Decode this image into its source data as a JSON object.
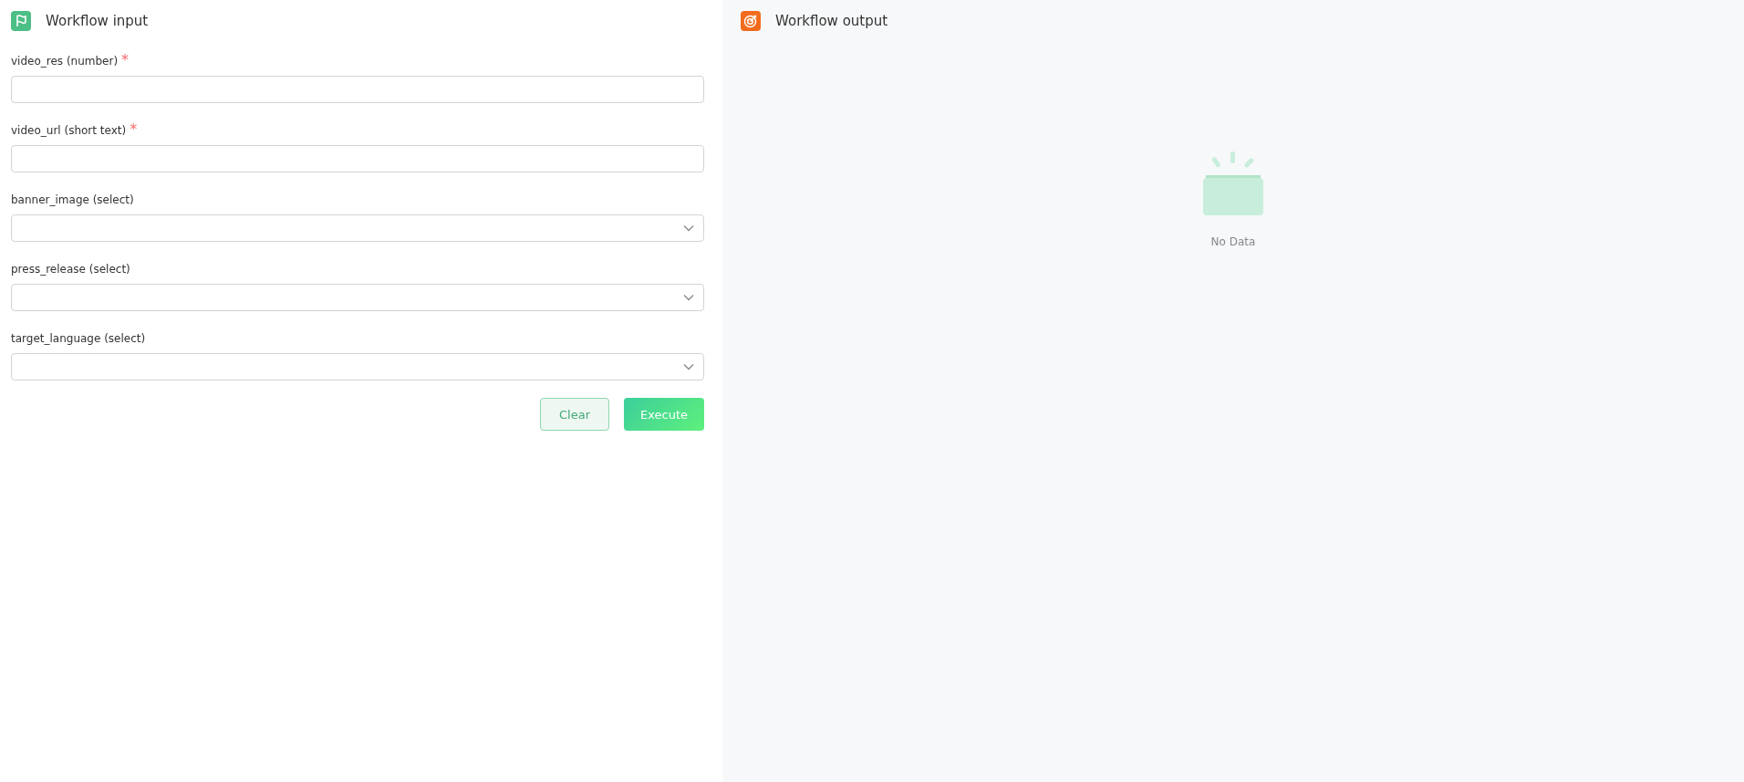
{
  "input_panel": {
    "title": "Workflow input",
    "fields": [
      {
        "label": "video_res (number)",
        "required_mark": "*",
        "kind": "text"
      },
      {
        "label": "video_url (short text)",
        "required_mark": "*",
        "kind": "text"
      },
      {
        "label": "banner_image (select)",
        "kind": "select"
      },
      {
        "label": "press_release (select)",
        "kind": "select"
      },
      {
        "label": "target_language (select)",
        "kind": "select"
      }
    ],
    "buttons": [
      {
        "label": "Clear",
        "kind": "secondary"
      },
      {
        "label": "Execute",
        "kind": "primary"
      }
    ]
  },
  "output_panel": {
    "title": "Workflow output",
    "empty_text": "No Data"
  }
}
